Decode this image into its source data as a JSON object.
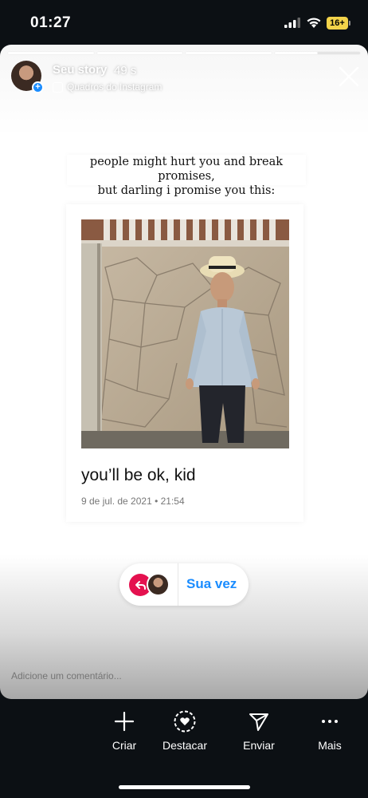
{
  "status_bar": {
    "time": "01:27",
    "battery_label": "16+",
    "battery_color": "#f3d34a"
  },
  "story": {
    "progress_segments": 4,
    "username": "Seu story",
    "time_ago": "49 s",
    "source": "Quadros do Instagram",
    "quote_line1": "people might hurt you and break promises,",
    "quote_line2": "but darling i promise you this:",
    "caption": "you’ll be ok, kid",
    "photo_date": "9 de jul. de 2021 • 21:54",
    "your_turn_label": "Sua vez",
    "comment_placeholder": "Adicione um comentário..."
  },
  "actions": [
    {
      "label": "Criar",
      "icon": "plus-icon"
    },
    {
      "label": "Destacar",
      "icon": "highlight-heart-icon"
    },
    {
      "label": "Enviar",
      "icon": "send-icon"
    },
    {
      "label": "Mais",
      "icon": "more-dots-icon"
    }
  ],
  "colors": {
    "accent_blue": "#1a8cff",
    "reply_pink": "#e4114f",
    "background": "#0c1014"
  }
}
